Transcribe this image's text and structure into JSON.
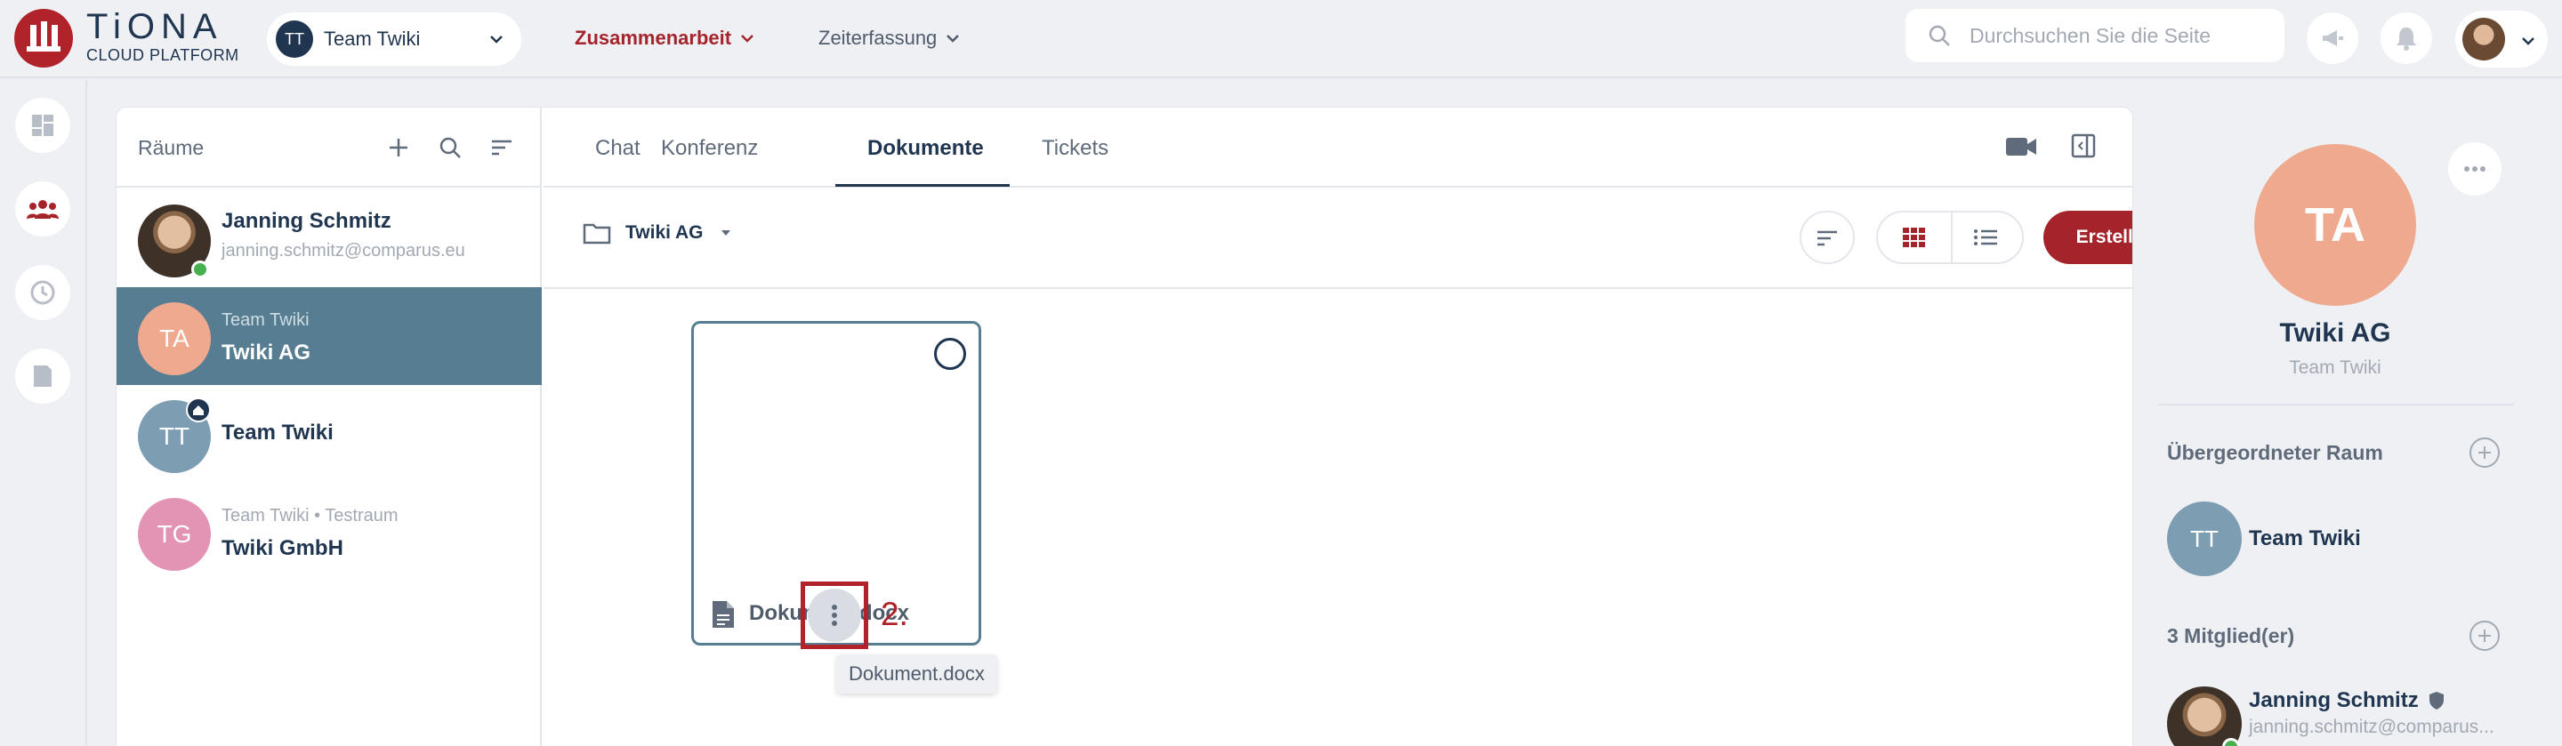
{
  "brand": {
    "name": "TiONA",
    "sub": "CLOUD PLATFORM",
    "accent": "#b0232a"
  },
  "team_select": {
    "initials": "TT",
    "label": "Team Twiki"
  },
  "nav": {
    "active": "Zusammenarbeit",
    "other": "Zeiterfassung"
  },
  "search": {
    "placeholder": "Durchsuchen Sie die Seite"
  },
  "rooms": {
    "title": "Räume",
    "items": [
      {
        "initials": "",
        "sub": "janning.schmitz@comparus.eu",
        "name": "Janning Schmitz",
        "color": "#8a6547"
      },
      {
        "initials": "TA",
        "sub": "Team Twiki",
        "name": "Twiki AG",
        "color": "#efa98f"
      },
      {
        "initials": "TT",
        "sub": "",
        "name": "Team Twiki",
        "color": "#7d9db2"
      },
      {
        "initials": "TG",
        "sub": "Team Twiki • Testraum",
        "name": "Twiki GmbH",
        "color": "#e394b5"
      }
    ]
  },
  "tabs": [
    "Chat",
    "Konferenz",
    "Dokumente",
    "Tickets"
  ],
  "folder": {
    "name": "Twiki AG"
  },
  "create_label": "Erstellen",
  "document": {
    "name": "Dokument.docx",
    "tooltip": "Dokument.docx"
  },
  "step_label": "2.",
  "right_panel": {
    "initials": "TA",
    "title": "Twiki AG",
    "subtitle": "Team Twiki",
    "parent_section": "Übergeordneter Raum",
    "parent_initials": "TT",
    "parent_name": "Team Twiki",
    "members_section": "3 Mitglied(er)",
    "member_name": "Janning Schmitz",
    "member_mail": "janning.schmitz@comparus..."
  }
}
